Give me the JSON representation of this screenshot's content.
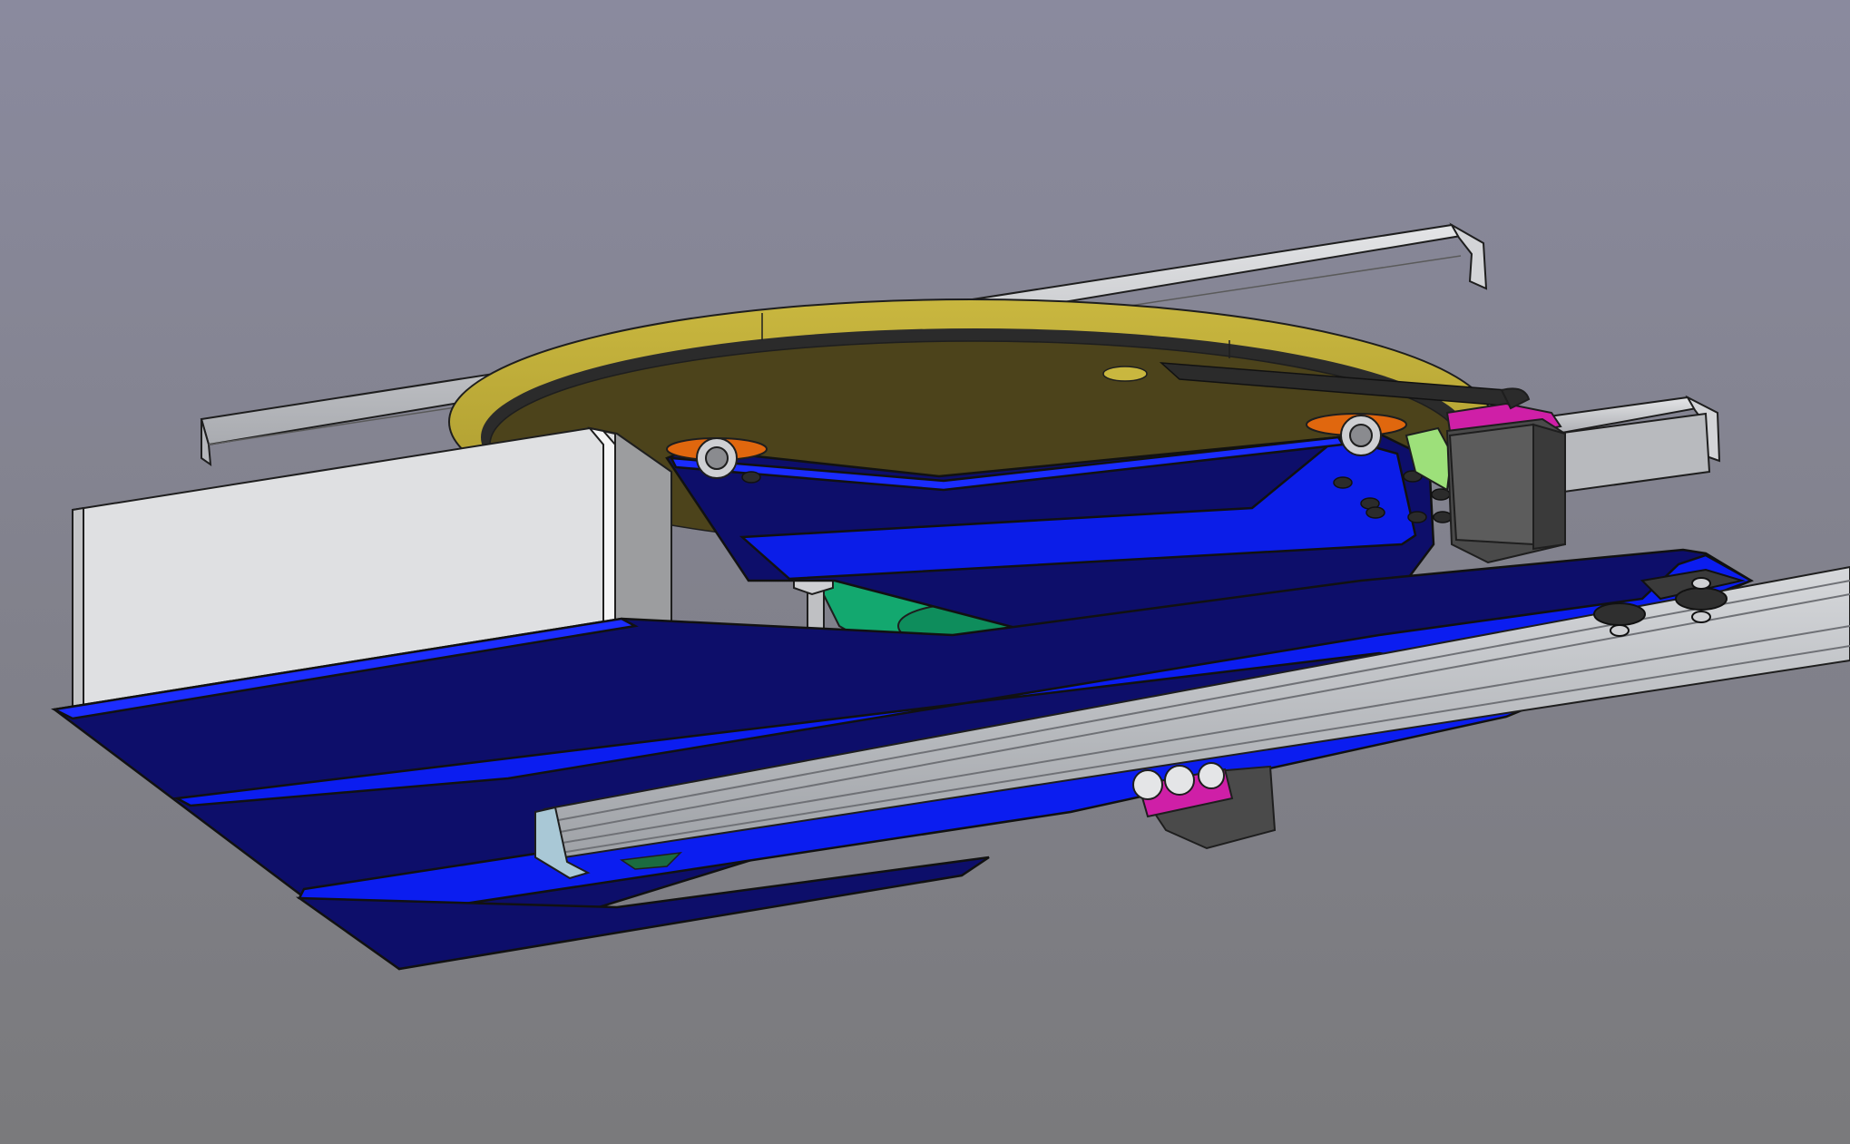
{
  "scene": {
    "kind": "cad-3d-viewport",
    "background": {
      "top": "#8a8a9e",
      "bottom": "#7a7a7c"
    },
    "parts": [
      {
        "name": "rail-rear",
        "color": "#c9cbcf"
      },
      {
        "name": "rail-right-short",
        "color": "#c9cbcf"
      },
      {
        "name": "turntable-disc",
        "color": "#b9a737"
      },
      {
        "name": "turntable-top-face",
        "color": "#4c431b"
      },
      {
        "name": "turntable-belt",
        "color": "#2b2b2b"
      },
      {
        "name": "enclosure-box",
        "color": "#dfe0e2"
      },
      {
        "name": "base-plate-blue",
        "color": "#0d0e6a"
      },
      {
        "name": "base-plate-bevel",
        "color": "#0b1df0"
      },
      {
        "name": "upper-bracket-blue",
        "color": "#0b1de8"
      },
      {
        "name": "green-hub",
        "color": "#13a86f"
      },
      {
        "name": "stepper-motor",
        "color": "#4a4a4a"
      },
      {
        "name": "motor-mount-magenta",
        "color": "#cf1fa7"
      },
      {
        "name": "bearing-orange",
        "color": "#e0670e"
      },
      {
        "name": "aluminum-extrusion",
        "color": "#bfc2c6"
      },
      {
        "name": "idler-wheel",
        "color": "#2f2f2f"
      },
      {
        "name": "lower-motor-block",
        "color": "#4a4a4a"
      },
      {
        "name": "accent-lime",
        "color": "#9de07a"
      }
    ]
  }
}
